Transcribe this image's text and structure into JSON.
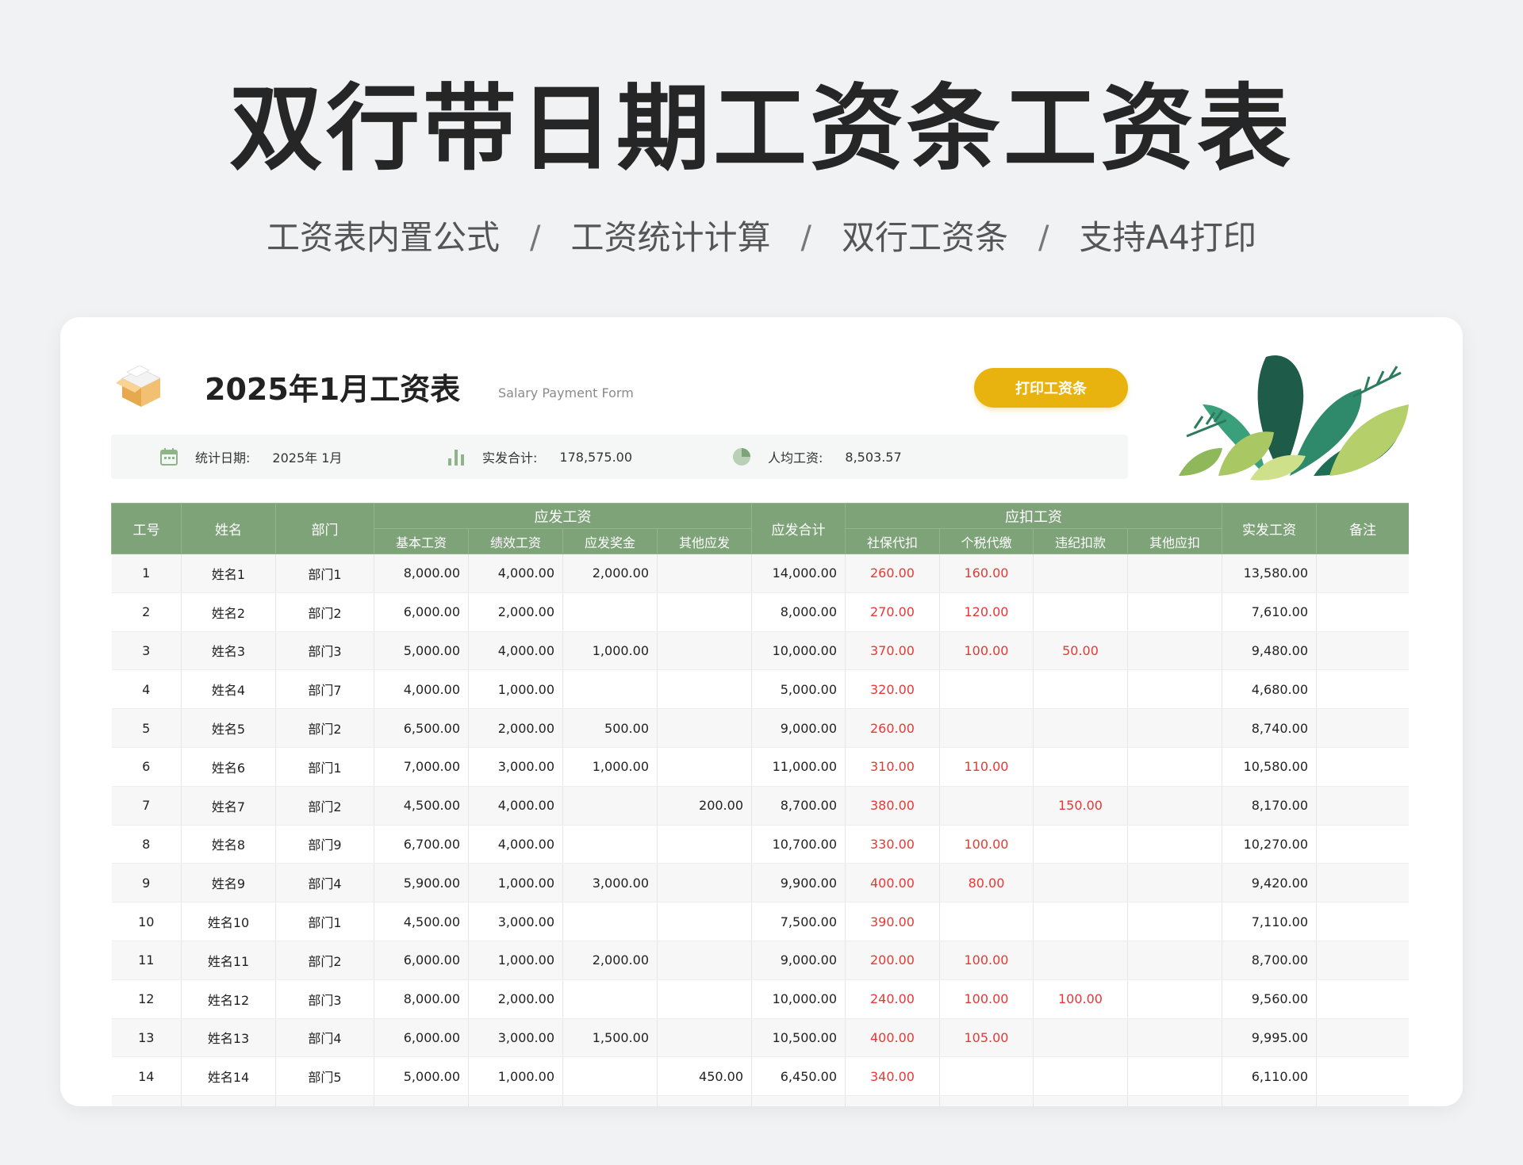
{
  "hero": {
    "title": "双行带日期工资条工资表",
    "features": [
      "工资表内置公式",
      "工资统计计算",
      "双行工资条",
      "支持A4打印"
    ],
    "separator": "/"
  },
  "sheet": {
    "title": "2025年1月工资表",
    "subtitle": "Salary Payment Form",
    "print_button": "打印工资条",
    "colors": {
      "header_green": "#7ea379",
      "accent_yellow": "#e9b30f",
      "deduction_red": "#e53935"
    }
  },
  "stats": {
    "date_label": "统计日期:",
    "date_value": "2025年 1月",
    "total_label": "实发合计:",
    "total_value": "178,575.00",
    "avg_label": "人均工资:",
    "avg_value": "8,503.57",
    "icons": [
      "calendar-icon",
      "bar-chart-icon",
      "pie-chart-icon"
    ]
  },
  "table": {
    "headers": {
      "id": "工号",
      "name": "姓名",
      "dept": "部门",
      "payable_group": "应发工资",
      "base": "基本工资",
      "performance": "绩效工资",
      "bonus": "应发奖金",
      "other_payable": "其他应发",
      "payable_total": "应发合计",
      "deduct_group": "应扣工资",
      "social": "社保代扣",
      "tax": "个税代缴",
      "penalty": "违纪扣款",
      "other_deduct": "其他应扣",
      "net": "实发工资",
      "remark": "备注"
    },
    "rows": [
      [
        "1",
        "姓名1",
        "部门1",
        "8,000.00",
        "4,000.00",
        "2,000.00",
        "",
        "14,000.00",
        "260.00",
        "160.00",
        "",
        "",
        "13,580.00",
        ""
      ],
      [
        "2",
        "姓名2",
        "部门2",
        "6,000.00",
        "2,000.00",
        "",
        "",
        "8,000.00",
        "270.00",
        "120.00",
        "",
        "",
        "7,610.00",
        ""
      ],
      [
        "3",
        "姓名3",
        "部门3",
        "5,000.00",
        "4,000.00",
        "1,000.00",
        "",
        "10,000.00",
        "370.00",
        "100.00",
        "50.00",
        "",
        "9,480.00",
        ""
      ],
      [
        "4",
        "姓名4",
        "部门7",
        "4,000.00",
        "1,000.00",
        "",
        "",
        "5,000.00",
        "320.00",
        "",
        "",
        "",
        "4,680.00",
        ""
      ],
      [
        "5",
        "姓名5",
        "部门2",
        "6,500.00",
        "2,000.00",
        "500.00",
        "",
        "9,000.00",
        "260.00",
        "",
        "",
        "",
        "8,740.00",
        ""
      ],
      [
        "6",
        "姓名6",
        "部门1",
        "7,000.00",
        "3,000.00",
        "1,000.00",
        "",
        "11,000.00",
        "310.00",
        "110.00",
        "",
        "",
        "10,580.00",
        ""
      ],
      [
        "7",
        "姓名7",
        "部门2",
        "4,500.00",
        "4,000.00",
        "",
        "200.00",
        "8,700.00",
        "380.00",
        "",
        "150.00",
        "",
        "8,170.00",
        ""
      ],
      [
        "8",
        "姓名8",
        "部门9",
        "6,700.00",
        "4,000.00",
        "",
        "",
        "10,700.00",
        "330.00",
        "100.00",
        "",
        "",
        "10,270.00",
        ""
      ],
      [
        "9",
        "姓名9",
        "部门4",
        "5,900.00",
        "1,000.00",
        "3,000.00",
        "",
        "9,900.00",
        "400.00",
        "80.00",
        "",
        "",
        "9,420.00",
        ""
      ],
      [
        "10",
        "姓名10",
        "部门1",
        "4,500.00",
        "3,000.00",
        "",
        "",
        "7,500.00",
        "390.00",
        "",
        "",
        "",
        "7,110.00",
        ""
      ],
      [
        "11",
        "姓名11",
        "部门2",
        "6,000.00",
        "1,000.00",
        "2,000.00",
        "",
        "9,000.00",
        "200.00",
        "100.00",
        "",
        "",
        "8,700.00",
        ""
      ],
      [
        "12",
        "姓名12",
        "部门3",
        "8,000.00",
        "2,000.00",
        "",
        "",
        "10,000.00",
        "240.00",
        "100.00",
        "100.00",
        "",
        "9,560.00",
        ""
      ],
      [
        "13",
        "姓名13",
        "部门4",
        "6,000.00",
        "3,000.00",
        "1,500.00",
        "",
        "10,500.00",
        "400.00",
        "105.00",
        "",
        "",
        "9,995.00",
        ""
      ],
      [
        "14",
        "姓名14",
        "部门5",
        "5,000.00",
        "1,000.00",
        "",
        "450.00",
        "6,450.00",
        "340.00",
        "",
        "",
        "",
        "6,110.00",
        ""
      ],
      [
        "",
        "",
        "",
        "",
        "",
        "",
        "",
        "",
        "",
        "",
        "",
        "",
        "",
        ""
      ]
    ]
  }
}
